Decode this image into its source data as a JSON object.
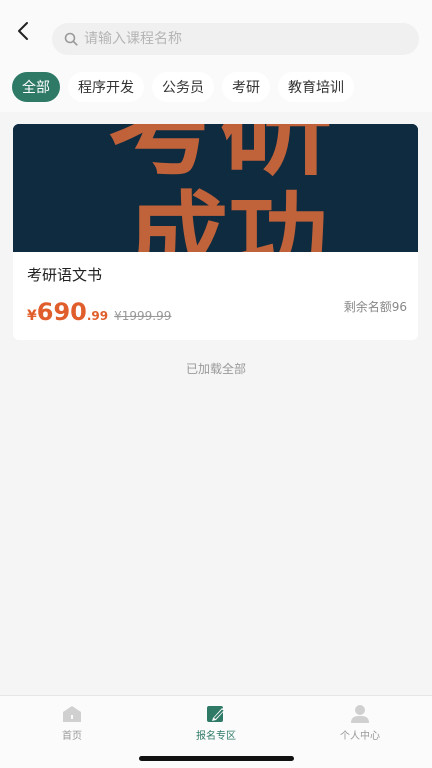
{
  "header": {
    "search_placeholder": "请输入课程名称"
  },
  "tabs": [
    {
      "label": "全部",
      "active": true
    },
    {
      "label": "程序开发",
      "active": false
    },
    {
      "label": "公务员",
      "active": false
    },
    {
      "label": "考研",
      "active": false
    },
    {
      "label": "教育培训",
      "active": false
    }
  ],
  "course": {
    "cover_text": [
      "考研",
      "成功"
    ],
    "title": "考研语文书",
    "price_symbol": "¥",
    "price_integer": "690",
    "price_decimal": ".99",
    "original_price": "¥1999.99",
    "quota": "剩余名额96"
  },
  "list_status": "已加载全部",
  "bottom_nav": [
    {
      "label": "首页",
      "icon": "home-icon",
      "active": false
    },
    {
      "label": "报名专区",
      "icon": "edit-icon",
      "active": true
    },
    {
      "label": "个人中心",
      "icon": "user-icon",
      "active": false
    }
  ],
  "colors": {
    "accent": "#2f7a67",
    "price": "#e05e2b",
    "cover_bg": "#0e2b3f",
    "cover_text": "#d4683a"
  }
}
